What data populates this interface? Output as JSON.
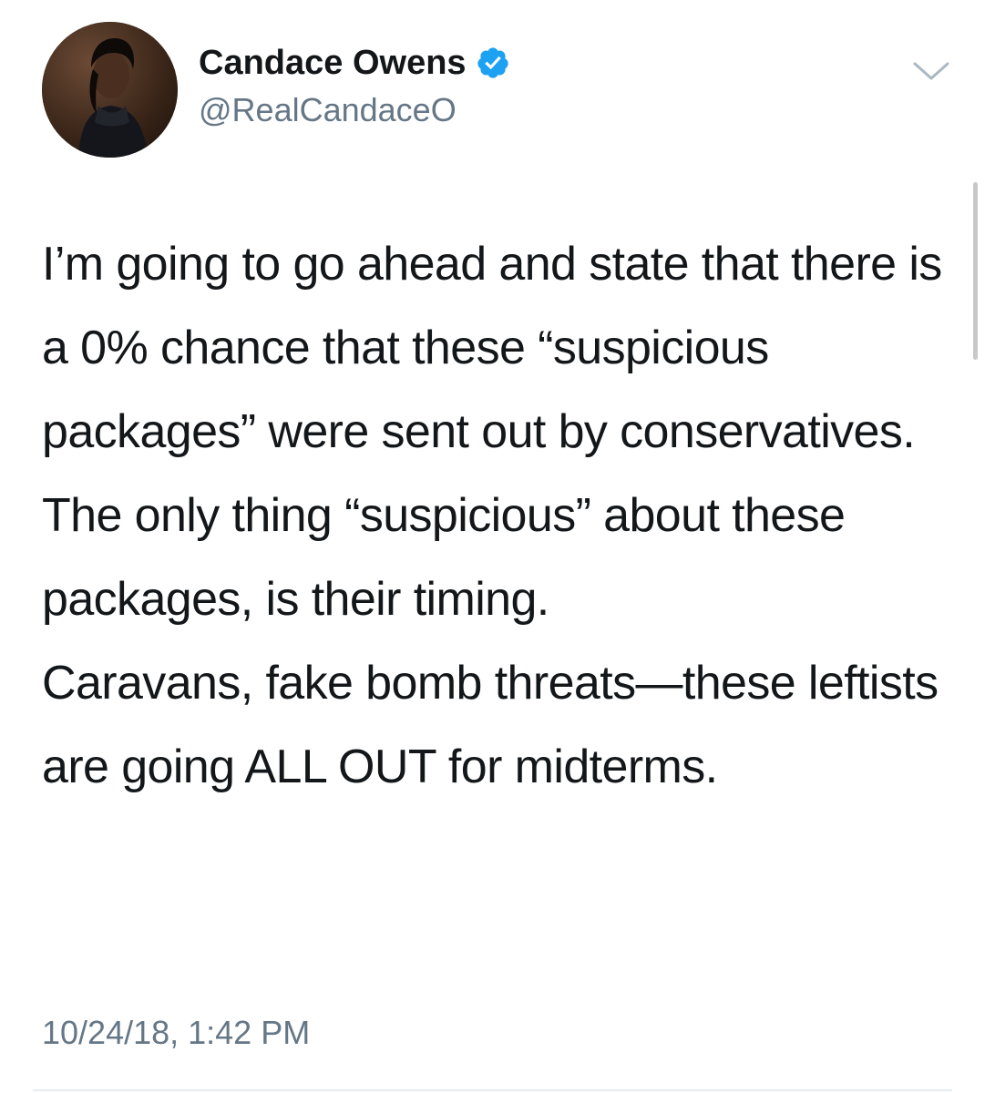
{
  "tweet": {
    "author": {
      "display_name": "Candace Owens",
      "handle": "@RealCandaceO",
      "verified": true,
      "avatar_icon": "profile-photo"
    },
    "menu_icon": "chevron-down-icon",
    "paragraphs": [
      "I’m going to go ahead and state that there is a 0% chance that these “suspicious packages” were sent out by conservatives.",
      "The only thing “suspicious” about these packages, is their timing.",
      "Caravans, fake bomb threats—these leftists are going ALL OUT for midterms."
    ],
    "timestamp": "10/24/18, 1:42 PM"
  },
  "colors": {
    "verified_blue": "#1da1f2",
    "secondary_text": "#657786",
    "primary_text": "#14171a"
  }
}
